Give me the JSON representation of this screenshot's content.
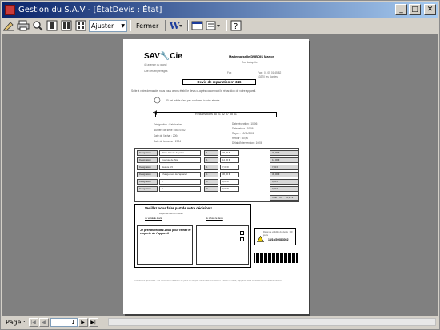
{
  "window": {
    "title": "Gestion du S.A.V - [ÉtatDevis : État]",
    "min": "_",
    "max": "□",
    "close": "✕"
  },
  "toolbar": {
    "zoom_value": "Ajuster",
    "close_label": "Fermer"
  },
  "report": {
    "logo": "SAV🔧Cie",
    "shop_addr_1": "45 avenue du grand",
    "shop_addr_2": "Cité des engrenages",
    "customer_name": "Mademoiselle DUBOIS Marion",
    "customer_addr_1": "Rue Lafayette",
    "customer_city_label": "Fax",
    "customer_city": "Fax : 01 05 01 45 82",
    "customer_addr_2": "10270 les Bordes",
    "devis_title": "Devis de reparation n° 346",
    "intro": "Suite à votre demande, nous vous avons établi le devis ci-après concernant le réparation de votre appareil.",
    "rpro": "Si cet article n'est pas conforme à votre attente",
    "rpro_box": "Réclamations au 01 42 87 55 31",
    "info_left": [
      "Désignation : Fabrication",
      "Numéro de série : 568 0452",
      "Date de l'achat : 2004",
      "Date de la panne : 2004"
    ],
    "info_right": [
      "Date réception : 10/06",
      "Date retour : 10/06",
      "Rayon : 10/11/2008",
      "Retour : 50,00",
      "Délai d'intervention : 10/06"
    ],
    "parts": [
      {
        "label": "Designation",
        "item": "Pièce d'usure de pièce",
        "qty": "1",
        "pu": "33,00 €",
        "total": "33,00 €"
      },
      {
        "label": "Designation",
        "item": "Courroie de Tête",
        "qty": "1",
        "pu": "12,00 €",
        "total": "12,00 €"
      },
      {
        "label": "Designation",
        "item": "Mesure 4.5",
        "qty": "1",
        "pu": "7,00 €",
        "total": "7,00 €"
      },
      {
        "label": "Designation",
        "item": "Changement de l'appareil",
        "qty": "1",
        "pu": "36,00 €",
        "total": "36,00 €"
      },
      {
        "label": "Designation",
        "item": "0",
        "qty": "0",
        "pu": "0,00 €",
        "total": "0,00 €"
      },
      {
        "label": "Designation",
        "item": "0",
        "qty": "0",
        "pu": "0,00 €",
        "total": "0,00 €"
      }
    ],
    "total_label": "Total TTC",
    "total_value": "91,37 €",
    "decision_title": "Veuillez nous faire part de votre décision !",
    "decision_sub": "Rayez la mention inutile",
    "decision_left_title": "Je valide le devis",
    "decision_right_title": "Je refuse le devis",
    "hand_note": "Je prends rendez-vous pour retrait et emporte de l'appareil",
    "warn_text": "Délai de validité du devis : 30 jours",
    "warn_code": "18/10/2008/3052",
    "footer": "Conditions générales : les devis sont valables 30 jours à compter de la date d'émission. Passé ce délai, l'appareil sera considéré comme abandonné."
  },
  "statusbar": {
    "page_label": "Page :",
    "page_value": "1",
    "first": "|◀",
    "prev": "◀",
    "next": "▶",
    "last": "▶|"
  },
  "colors": {
    "titlebar_start": "#0a246a",
    "titlebar_end": "#a6caf0",
    "preview_bg": "#808080"
  }
}
